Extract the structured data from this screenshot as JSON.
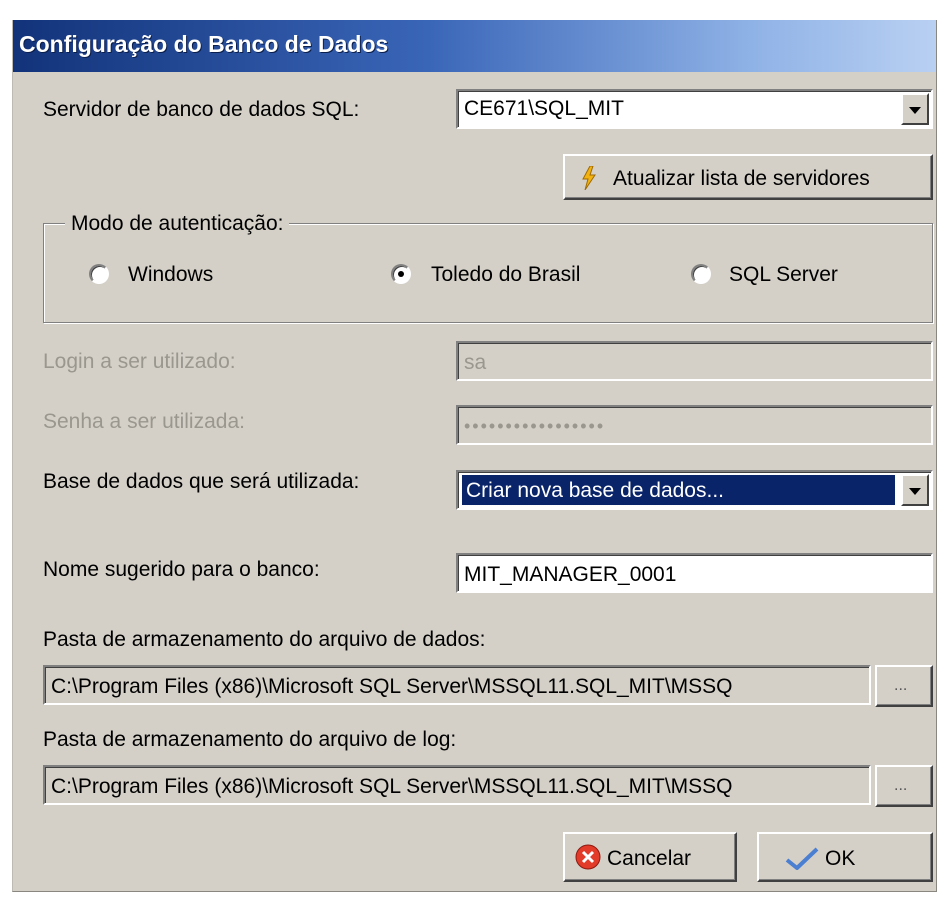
{
  "window": {
    "title": "Configuração do Banco de Dados"
  },
  "server": {
    "label": "Servidor de banco de dados SQL:",
    "value": "CE671\\SQL_MIT",
    "refresh_label": "Atualizar lista de servidores"
  },
  "auth": {
    "legend": "Modo de autenticação:",
    "options": [
      "Windows",
      "Toledo do Brasil",
      "SQL Server"
    ],
    "selected": "Toledo do Brasil"
  },
  "login": {
    "label": "Login a ser utilizado:",
    "value": "sa"
  },
  "password": {
    "label": "Senha a ser utilizada:",
    "value": "•••••••••••••••••"
  },
  "database": {
    "label": "Base de dados que será utilizada:",
    "value": "Criar nova base de dados..."
  },
  "db_name": {
    "label": "Nome sugerido para o banco:",
    "value": "MIT_MANAGER_0001"
  },
  "data_folder": {
    "label": "Pasta de armazenamento do arquivo de dados:",
    "value": "C:\\Program Files (x86)\\Microsoft SQL Server\\MSSQL11.SQL_MIT\\MSSQ",
    "browse_label": "..."
  },
  "log_folder": {
    "label": "Pasta de armazenamento do arquivo de log:",
    "value": "C:\\Program Files (x86)\\Microsoft SQL Server\\MSSQL11.SQL_MIT\\MSSQ",
    "browse_label": "..."
  },
  "buttons": {
    "cancel": "Cancelar",
    "ok": "OK"
  },
  "colors": {
    "dialog_bg": "#d4d0c8",
    "title_start": "#12337a",
    "title_end": "#b9d0f2",
    "selection": "#0a246a",
    "disabled_text": "#9a978f"
  },
  "icons": {
    "refresh": "lightning-refresh-icon",
    "cancel": "red-x-icon",
    "ok": "checkmark-icon"
  }
}
